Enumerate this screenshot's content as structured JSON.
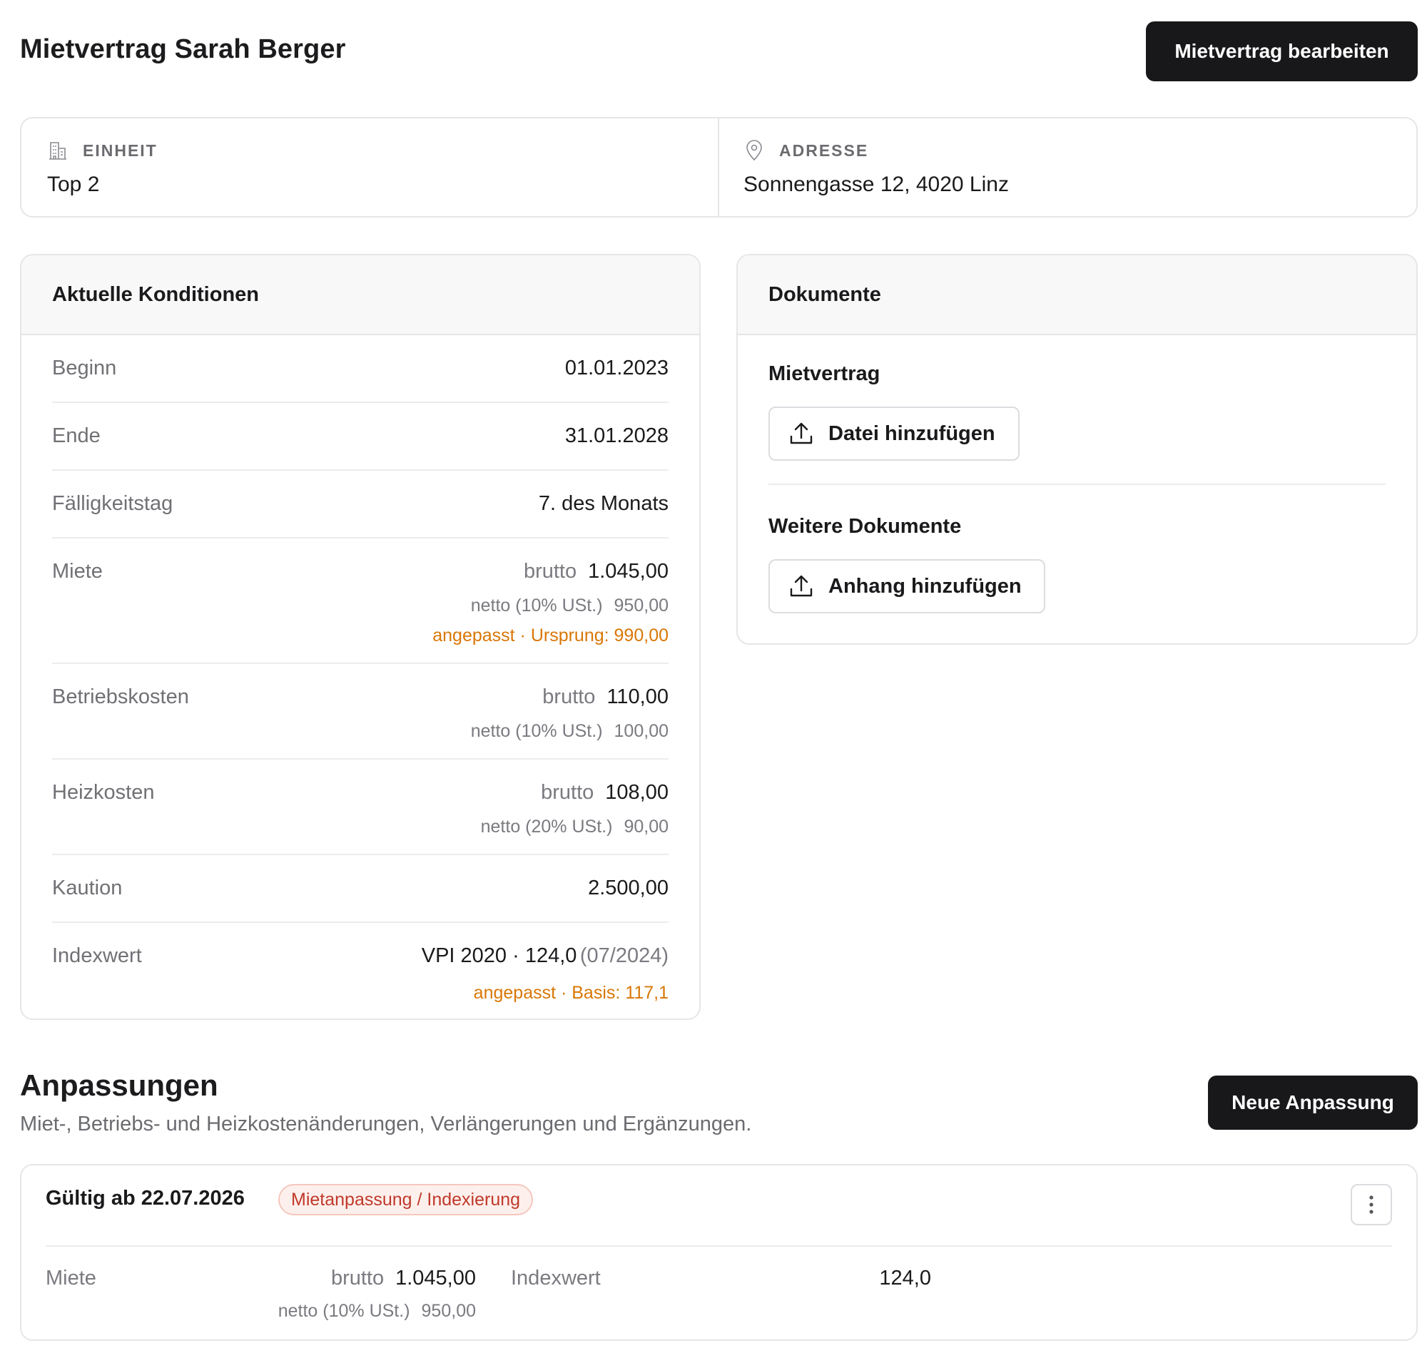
{
  "header": {
    "title": "Mietvertrag Sarah Berger",
    "edit_button": "Mietvertrag bearbeiten"
  },
  "info": {
    "unit_label": "EINHEIT",
    "unit_value": "Top 2",
    "unit_icon": "building-icon",
    "address_label": "ADRESSE",
    "address_value": "Sonnengasse 12, 4020 Linz",
    "address_icon": "map-pin-icon"
  },
  "conditions": {
    "title": "Aktuelle Konditionen",
    "begin": {
      "label": "Beginn",
      "value": "01.01.2023"
    },
    "end": {
      "label": "Ende",
      "value": "31.01.2028"
    },
    "due_day": {
      "label": "Fälligkeitstag",
      "value": "7. des Monats"
    },
    "rent": {
      "label": "Miete",
      "brutto_label": "brutto",
      "brutto_value": "1.045,00",
      "netto_label": "netto (10% USt.)",
      "netto_value": "950,00",
      "note": "angepasst · Ursprung: 990,00"
    },
    "operating_costs": {
      "label": "Betriebskosten",
      "brutto_label": "brutto",
      "brutto_value": "110,00",
      "netto_label": "netto (10% USt.)",
      "netto_value": "100,00"
    },
    "heating_costs": {
      "label": "Heizkosten",
      "brutto_label": "brutto",
      "brutto_value": "108,00",
      "netto_label": "netto (20% USt.)",
      "netto_value": "90,00"
    },
    "deposit": {
      "label": "Kaution",
      "value": "2.500,00"
    },
    "index": {
      "label": "Indexwert",
      "value": "VPI 2020 · 124,0",
      "period": "(07/2024)",
      "note": "angepasst · Basis: 117,1"
    }
  },
  "documents": {
    "title": "Dokumente",
    "contract_title": "Mietvertrag",
    "contract_button": "Datei hinzufügen",
    "other_title": "Weitere Dokumente",
    "other_button": "Anhang hinzufügen",
    "upload_icon": "upload-icon"
  },
  "adjustments": {
    "title": "Anpassungen",
    "subtitle": "Miet-, Betriebs- und Heizkostenänderungen, Verlängerungen und Ergänzungen.",
    "new_button": "Neue Anpassung",
    "items": [
      {
        "valid_from": "Gültig ab 22.07.2026",
        "badge": "Mietanpassung / Indexierung",
        "rent_label": "Miete",
        "brutto_label": "brutto",
        "brutto_value": "1.045,00",
        "netto_label": "netto (10% USt.)",
        "netto_value": "950,00",
        "index_label": "Indexwert",
        "index_value": "124,0"
      }
    ]
  },
  "colors": {
    "primary_button": "#18181b",
    "warning": "#d97706",
    "badge_text": "#c0392b",
    "badge_bg": "#fdf0ec"
  }
}
